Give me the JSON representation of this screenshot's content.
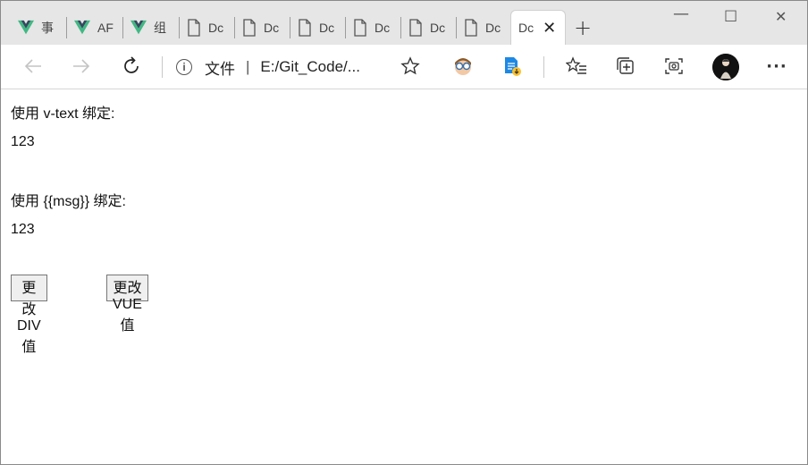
{
  "tabs": [
    {
      "label": "事",
      "icon": "vue-icon"
    },
    {
      "label": "AF",
      "icon": "vue-icon"
    },
    {
      "label": "组",
      "icon": "vue-icon"
    },
    {
      "label": "Dc",
      "icon": "document-icon"
    },
    {
      "label": "Dc",
      "icon": "document-icon"
    },
    {
      "label": "Dc",
      "icon": "document-icon"
    },
    {
      "label": "Dc",
      "icon": "document-icon"
    },
    {
      "label": "Dc",
      "icon": "document-icon"
    },
    {
      "label": "Dc",
      "icon": "document-icon"
    }
  ],
  "active_tab": {
    "label": "Dc",
    "close": "✕"
  },
  "new_tab": "+",
  "window_controls": {
    "minimize": "—",
    "maximize": "☐",
    "close": "✕"
  },
  "address": {
    "label": "文件",
    "separator": "|",
    "url": "E:/Git_Code/..."
  },
  "toolbar_icons": [
    "back-icon",
    "forward-icon",
    "refresh-icon",
    "favorite-star-icon",
    "extension-icon",
    "extension-icon",
    "favorites-icon",
    "collections-icon",
    "screenshot-icon",
    "profile-avatar",
    "more-icon"
  ],
  "more": "···",
  "page": {
    "line1": "使用 v-text 绑定:",
    "value1": "123",
    "line2": "使用 {{msg}} 绑定:",
    "value2": "123",
    "button1": "更改DIV值",
    "button2": "更改VUE值"
  },
  "colors": {
    "tabstrip": "#e6e6e6",
    "vue_green": "#41b883",
    "vue_dark": "#34495e"
  }
}
